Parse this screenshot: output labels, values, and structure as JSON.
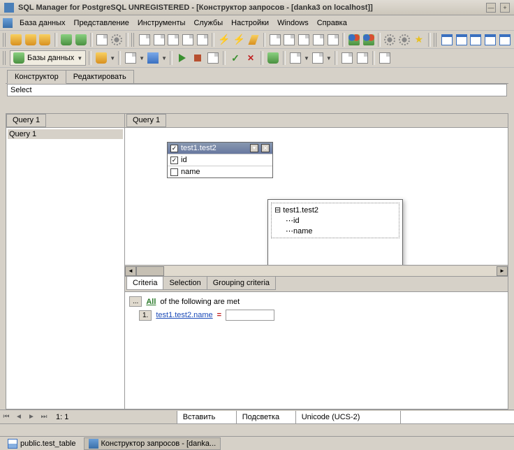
{
  "title": "SQL Manager for PostgreSQL UNREGISTERED - [Конструктор запросов - [danka3 on localhost]]",
  "menu": {
    "m1": "База данных",
    "m2": "Представление",
    "m3": "Инструменты",
    "m4": "Службы",
    "m5": "Настройки",
    "m6": "Windows",
    "m7": "Справка"
  },
  "toolbar3": {
    "databases": "Базы данных"
  },
  "main_tabs": {
    "t1": "Конструктор",
    "t2": "Редактировать"
  },
  "select_text": "Select",
  "left_tree": {
    "q1": "Query 1"
  },
  "right_tabs": {
    "q1": "Query 1"
  },
  "tablebox": {
    "title": "test1.test2",
    "cols": {
      "c1": "id",
      "c2": "name"
    }
  },
  "popup": {
    "root": "test1.test2",
    "items": {
      "i1": "id",
      "i2": "name"
    }
  },
  "bottom_tabs": {
    "b1": "Criteria",
    "b2": "Selection",
    "b3": "Grouping criteria"
  },
  "criteria": {
    "btn_dots": "...",
    "all": "All",
    "all_text": "of the following are met",
    "idx": "1.",
    "link": "test1.test2.name",
    "eq": "="
  },
  "nav": {
    "pos": "1:   1"
  },
  "statusbar": {
    "s1": "Вставить",
    "s2": "Подсветка",
    "s3": "Unicode (UCS-2)"
  },
  "taskbar": {
    "t1": "public.test_table",
    "t2": "Конструктор запросов - [danka..."
  }
}
